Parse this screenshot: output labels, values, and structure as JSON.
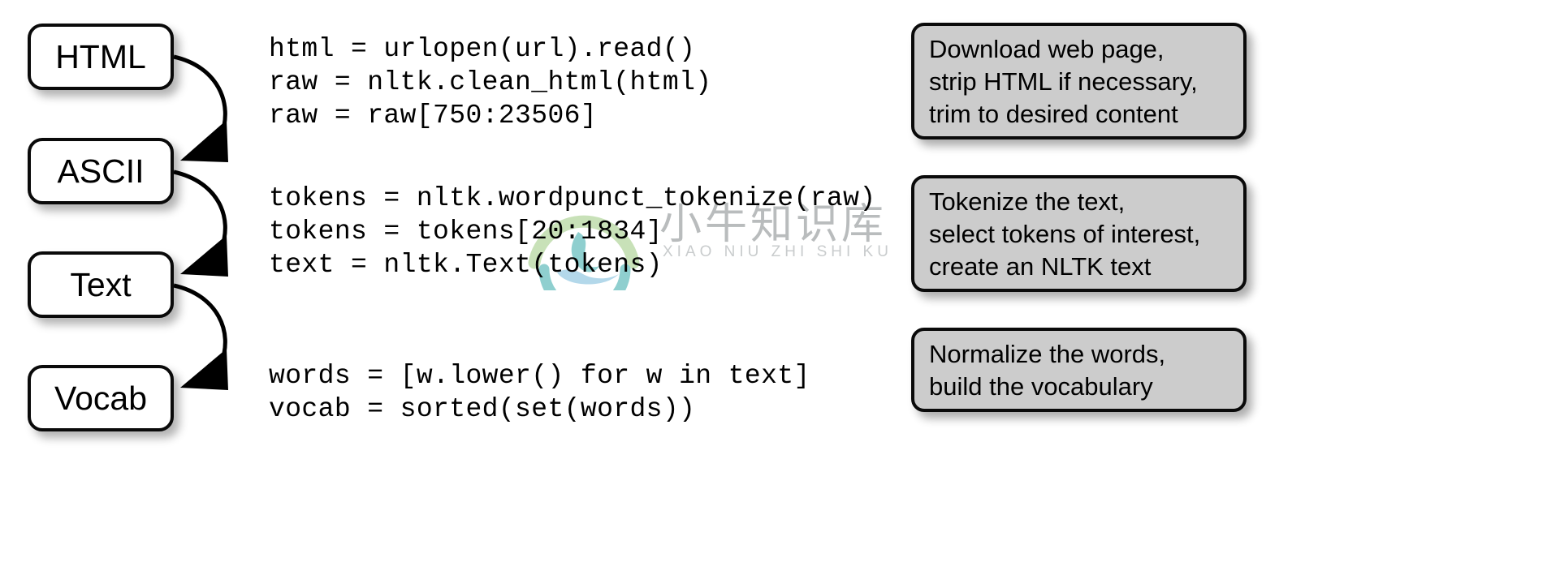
{
  "diagram": {
    "title": "NLTK text processing pipeline",
    "pipeline_boxes": [
      {
        "label": "HTML",
        "name": "flow-box-html"
      },
      {
        "label": "ASCII",
        "name": "flow-box-ascii"
      },
      {
        "label": "Text",
        "name": "flow-box-text"
      },
      {
        "label": "Vocab",
        "name": "flow-box-vocab"
      }
    ],
    "code_blocks": [
      {
        "id": "code-block-download",
        "lines": [
          "html = urlopen(url).read()",
          "raw = nltk.clean_html(html)",
          "raw = raw[750:23506]"
        ]
      },
      {
        "id": "code-block-tokenize",
        "lines": [
          "tokens = nltk.wordpunct_tokenize(raw)",
          "tokens = tokens[20:1834]",
          "text = nltk.Text(tokens)"
        ]
      },
      {
        "id": "code-block-normalize",
        "lines": [
          "words = [w.lower() for w in text]",
          "vocab = sorted(set(words))"
        ]
      }
    ],
    "notes": [
      {
        "id": "note-box-download",
        "lines": [
          "Download web page,",
          "strip HTML if necessary,",
          "trim to desired content"
        ]
      },
      {
        "id": "note-box-tokenize",
        "lines": [
          "Tokenize the text,",
          "select tokens of interest,",
          "create an NLTK text"
        ]
      },
      {
        "id": "note-box-normalize",
        "lines": [
          "Normalize the words,",
          "build the vocabulary"
        ]
      }
    ],
    "watermark": {
      "text": "小牛知识库",
      "subtext": "XIAO NIU ZHI SHI KU"
    },
    "colors": {
      "note_fill": "#cccccc",
      "box_fill": "#ffffff",
      "stroke": "#0a0a0a",
      "watermark_green": "#a8d08d",
      "watermark_teal": "#4cb3b3",
      "watermark_blue": "#85c1de",
      "watermark_gray": "#b9bcbd"
    }
  }
}
